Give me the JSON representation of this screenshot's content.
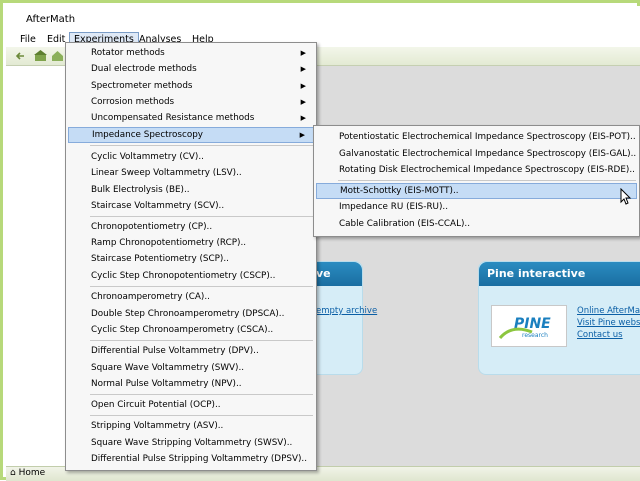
{
  "app": {
    "title": "AfterMath"
  },
  "menubar": [
    {
      "label": "File"
    },
    {
      "label": "Edit"
    },
    {
      "label": "Experiments"
    },
    {
      "label": "Analyses"
    },
    {
      "label": "Help"
    }
  ],
  "experiments_menu": {
    "groups": [
      [
        "Rotator methods",
        "Dual electrode methods",
        "Spectrometer methods",
        "Corrosion methods",
        "Uncompensated Resistance methods",
        "Impedance Spectroscopy"
      ],
      [
        "Cyclic Voltammetry (CV)..",
        "Linear Sweep Voltammetry (LSV)..",
        "Bulk Electrolysis (BE)..",
        "Staircase Voltammetry (SCV).."
      ],
      [
        "Chronopotentiometry (CP)..",
        "Ramp Chronopotentiometry (RCP)..",
        "Staircase Potentiometry (SCP)..",
        "Cyclic Step Chronopotentiometry (CSCP).."
      ],
      [
        "Chronoamperometry (CA)..",
        "Double Step Chronoamperometry (DPSCA)..",
        "Cyclic Step Chronoamperometry (CSCA).."
      ],
      [
        "Differential Pulse Voltammetry (DPV)..",
        "Square Wave Voltammetry (SWV)..",
        "Normal Pulse Voltammetry (NPV).."
      ],
      [
        "Open Circuit Potential (OCP).."
      ],
      [
        "Stripping Voltammetry (ASV)..",
        "Square Wave Stripping Voltammetry (SWSV)..",
        "Differential Pulse Stripping Voltammetry (DPSV).."
      ]
    ]
  },
  "impedance_submenu": {
    "groups": [
      [
        "Potentiostatic Electrochemical Impedance Spectroscopy (EIS-POT)..",
        "Galvanostatic Electrochemical Impedance Spectroscopy (EIS-GAL)..",
        "Rotating Disk Electrochemical Impedance Spectroscopy (EIS-RDE).."
      ],
      [
        "Mott-Schottky (EIS-MOTT)..",
        "Impedance RU (EIS-RU)..",
        "Cable Calibration (EIS-CCAL).."
      ]
    ]
  },
  "cards": {
    "left_header": "ve",
    "left_link": "empty archive",
    "right_header": "Pine interactive",
    "right_links": [
      "Online AfterMat",
      "Visit Pine websi",
      "Contact us"
    ],
    "logo_text": "PINE",
    "logo_sub": "research"
  },
  "statusbar": {
    "home_label": "Home"
  },
  "colors": {
    "accent": "#1a6ea1",
    "frame": "#b7d97a",
    "highlight": "#c5dcf5"
  }
}
